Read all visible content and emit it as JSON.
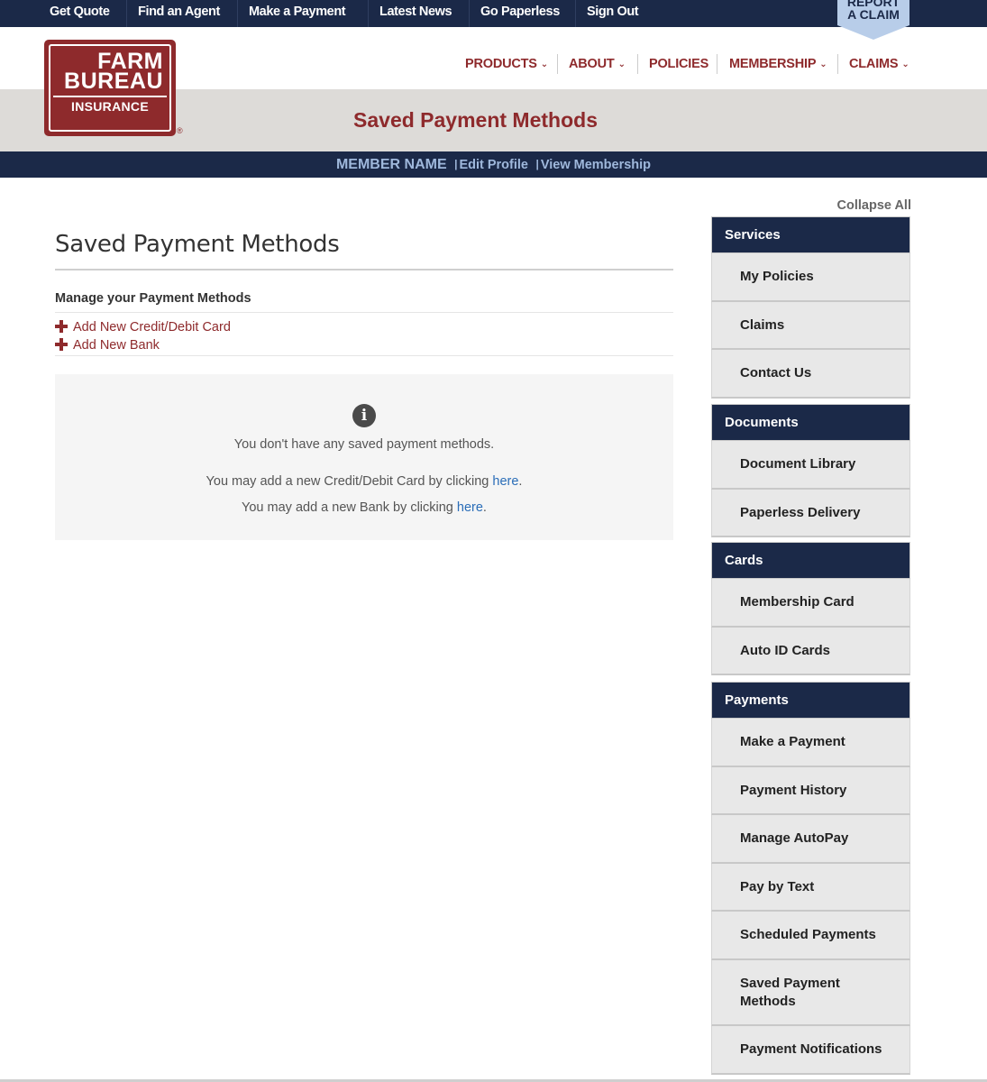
{
  "utility_nav": {
    "get_quote": "Get Quote",
    "find_agent": "Find an Agent",
    "make_payment": "Make a Payment",
    "latest_news": "Latest News",
    "go_paperless": "Go Paperless",
    "sign_out": "Sign Out",
    "report_claim_line1": "REPORT",
    "report_claim_line2": "A CLAIM"
  },
  "logo": {
    "farm": "FARM",
    "bureau": "BUREAU",
    "insurance": "INSURANCE",
    "registered": "®"
  },
  "main_nav": {
    "products": "PRODUCTS",
    "about": "ABOUT",
    "policies": "POLICIES",
    "membership": "MEMBERSHIP",
    "claims": "CLAIMS",
    "caret": "⌄"
  },
  "header": {
    "page_title": "Saved Payment Methods"
  },
  "member_bar": {
    "member_name": "MEMBER NAME",
    "separator": "|",
    "edit_profile": "Edit Profile",
    "view_membership": "View Membership"
  },
  "main": {
    "title": "Saved Payment Methods",
    "manage_heading": "Manage your Payment Methods",
    "add_card": "Add New Credit/Debit Card",
    "add_bank": "Add New Bank",
    "info_icon": "info-icon",
    "empty_message": "You don't have any saved payment methods.",
    "card_msg_prefix": "You may add a new Credit/Debit Card by clicking ",
    "bank_msg_prefix": "You may add a new Bank by clicking ",
    "here": "here",
    "period": "."
  },
  "sidebar": {
    "collapse_all": "Collapse All",
    "sections": [
      {
        "heading": "Services",
        "items": [
          "My Policies",
          "Claims",
          "Contact Us"
        ]
      },
      {
        "heading": "Documents",
        "items": [
          "Document Library",
          "Paperless Delivery"
        ]
      },
      {
        "heading": "Cards",
        "items": [
          "Membership Card",
          "Auto ID Cards"
        ]
      },
      {
        "heading": "Payments",
        "items": [
          "Make a Payment",
          "Payment History",
          "Manage AutoPay",
          "Pay by Text",
          "Scheduled Payments",
          "Saved Payment Methods",
          "Payment Notifications"
        ]
      }
    ]
  },
  "colors": {
    "navy": "#1b2948",
    "brand_red": "#8e2a2c",
    "light_blue": "#b8cde9",
    "member_bar_text": "#9fb8dc",
    "link_blue": "#2a6db8",
    "band_gray": "#dddbd8",
    "sidebar_item_bg": "#e8e8e8"
  }
}
